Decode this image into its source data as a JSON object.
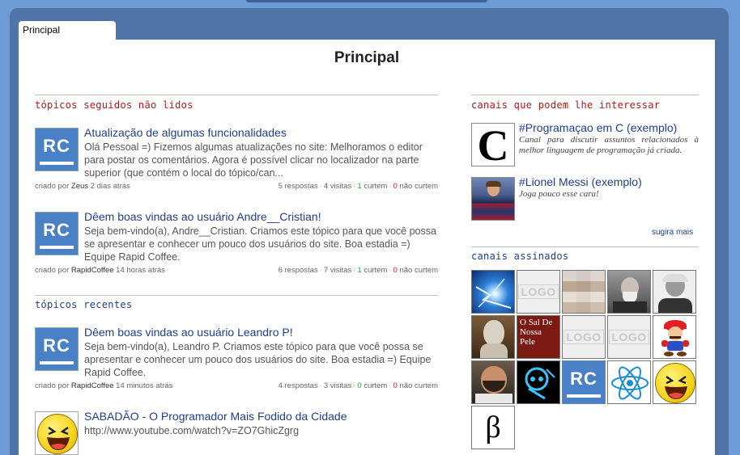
{
  "tab": {
    "label": "Principal"
  },
  "page": {
    "title": "Principal"
  },
  "sections": {
    "followed": "tópicos seguidos não lidos",
    "recent": "tópicos recentes",
    "suggested_channels": "canais que podem lhe interessar",
    "subscribed_channels": "canais assinados"
  },
  "followed_topics": [
    {
      "title": "Atualização de algumas funcionalidades",
      "body": "Olá Pessoal =) Fizemos algumas atualizações no site: Melhoramos o editor para postar os comentários. Agora é possível clicar no localizador na parte superior (que contém o local do tópico/can...",
      "created_prefix": "criado por",
      "author": "Zeus",
      "time": "2 dias atrás",
      "replies": "5 respostas",
      "visits": "4 visitas",
      "likes": "1",
      "likes_label": "curtem",
      "dislikes": "0",
      "dislikes_label": "não curtem"
    },
    {
      "title": "Dêem boas vindas ao usuário Andre__Cristian!",
      "body": "Seja bem-vindo(a), Andre__Cristian. Criamos este tópico para que você possa se apresentar e conhecer um pouco dos usuários do site. Boa estadia =) Equipe Rapid Coffee.",
      "created_prefix": "criado por",
      "author": "RapidCoffee",
      "time": "14 horas atrás",
      "replies": "6 respostas",
      "visits": "7 visitas",
      "likes": "1",
      "likes_label": "curtem",
      "dislikes": "0",
      "dislikes_label": "não curtem"
    }
  ],
  "recent_topics": [
    {
      "title": "Dêem boas vindas ao usuário Leandro P!",
      "body": "Seja bem-vindo(a), Leandro P. Criamos este tópico para que você possa se apresentar e conhecer um pouco dos usuários do site. Boa estadia =) Equipe Rapid Coffee.",
      "created_prefix": "criado por",
      "author": "RapidCoffee",
      "time": "14 minutos atrás",
      "replies": "4 respostas",
      "visits": "3 visitas",
      "likes": "0",
      "likes_label": "curtem",
      "dislikes": "0",
      "dislikes_label": "não curtem"
    },
    {
      "title": "SABADÃO - O Programador Mais Fodido da Cidade",
      "body": "http://www.youtube.com/watch?v=ZO7GhicZgrg"
    }
  ],
  "suggested": [
    {
      "title": "#Programaçao em C (exemplo)",
      "desc": "Canal para discutir assuntos relacionados à melhor linguagem de programação já criada.",
      "icon": "c-letter"
    },
    {
      "title": "#Lionel Messi (exemplo)",
      "desc": "Joga pouco esse cara!",
      "icon": "messi-photo"
    }
  ],
  "suggest_more": "sugira mais",
  "subscribed": [
    {
      "icon": "lightning-icon"
    },
    {
      "icon": "logo-placeholder",
      "text": "LOGO"
    },
    {
      "icon": "pixelated-icon"
    },
    {
      "icon": "freud-portrait"
    },
    {
      "icon": "old-man-portrait"
    },
    {
      "icon": "aristotle-bust"
    },
    {
      "icon": "o-sal-de-nossa-pele",
      "text": "O Sal De Nossa Pele"
    },
    {
      "icon": "logo-placeholder",
      "text": "LOGO"
    },
    {
      "icon": "logo-placeholder",
      "text": "LOGO"
    },
    {
      "icon": "mario-icon"
    },
    {
      "icon": "man-portrait"
    },
    {
      "icon": "xray-skull"
    },
    {
      "icon": "rc-logo",
      "text": "RC"
    },
    {
      "icon": "atom-icon"
    },
    {
      "icon": "laughing-smiley"
    },
    {
      "icon": "beta-symbol",
      "text": "β"
    }
  ]
}
